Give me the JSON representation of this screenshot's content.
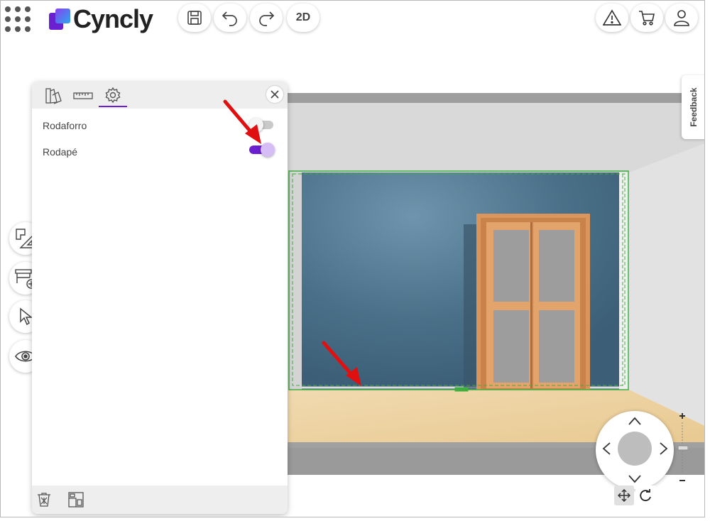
{
  "header": {
    "app_name": "Cyncly",
    "view_mode_label": "2D",
    "icons": [
      "apps-grid-icon",
      "save-icon",
      "undo-icon",
      "redo-icon",
      "warning-icon",
      "cart-icon",
      "user-icon"
    ]
  },
  "feedback": {
    "label": "Feedback"
  },
  "panel": {
    "tabs": [
      "palette-icon",
      "ruler-icon",
      "gear-icon"
    ],
    "active_tab": "gear-icon",
    "settings": [
      {
        "label": "Rodaforro",
        "enabled": false
      },
      {
        "label": "Rodapé",
        "enabled": true
      }
    ]
  },
  "colors": {
    "accent": "#6a1fd0",
    "accent_light": "#d7bdf6",
    "wall": "#456c84",
    "floor": "#eed4a4",
    "door_frame": "#d9955c",
    "selection": "#3fae3f",
    "annotation_arrow": "#e01010"
  },
  "left_tools": [
    "floorplan-icon",
    "add-furniture-icon",
    "select-cursor-icon",
    "visibility-eye-icon"
  ],
  "navigation": {
    "modes": [
      "pan-icon",
      "rotate-icon"
    ],
    "zoom_in": "+",
    "zoom_out": "−"
  }
}
